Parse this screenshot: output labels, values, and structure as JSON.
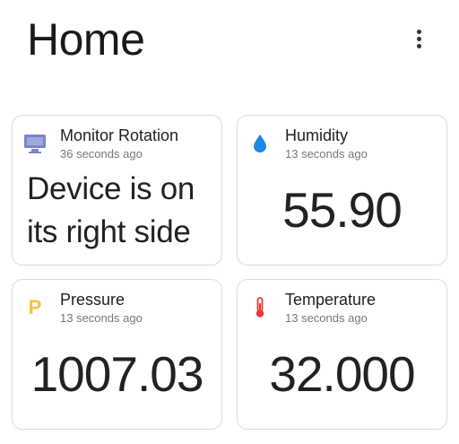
{
  "header": {
    "title": "Home",
    "menu_icon": "more-vert-icon"
  },
  "cards": [
    {
      "icon": "monitor-icon",
      "icon_color": "#7986cb",
      "title": "Monitor Rotation",
      "time": "36 seconds ago",
      "value": "Device is on its right side"
    },
    {
      "icon": "water-drop-icon",
      "icon_color": "#1e88e5",
      "title": "Humidity",
      "time": "13 seconds ago",
      "value": "55.90"
    },
    {
      "icon": "pressure-p-icon",
      "icon_color": "#f6c343",
      "icon_glyph": "P",
      "title": "Pressure",
      "time": "13 seconds ago",
      "value": "1007.03"
    },
    {
      "icon": "thermometer-icon",
      "icon_color": "#e53935",
      "title": "Temperature",
      "time": "13 seconds ago",
      "value": "32.000"
    }
  ]
}
